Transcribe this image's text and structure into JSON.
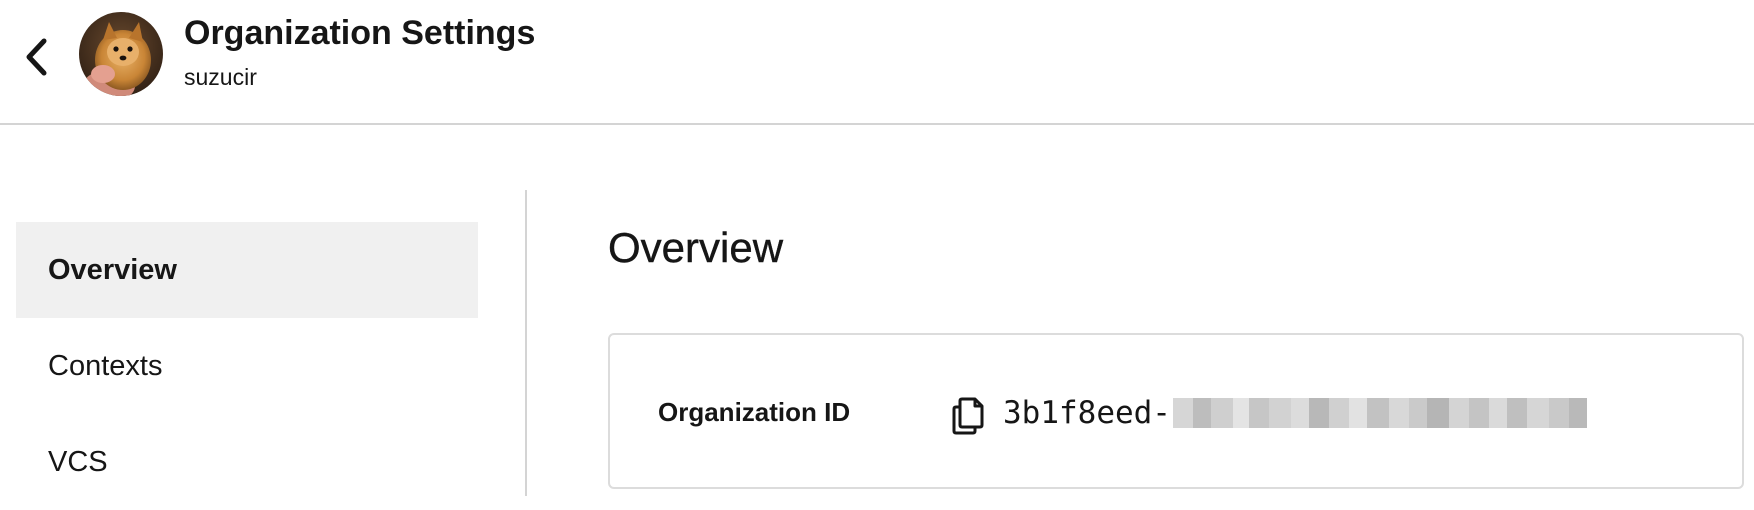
{
  "header": {
    "back_icon": "chevron-left-icon",
    "avatar_alt": "organization-avatar",
    "title": "Organization Settings",
    "subtitle": "suzucir"
  },
  "sidebar": {
    "items": [
      {
        "label": "Overview",
        "active": true
      },
      {
        "label": "Contexts",
        "active": false
      },
      {
        "label": "VCS",
        "active": false
      }
    ]
  },
  "main": {
    "title": "Overview",
    "card": {
      "field_label": "Organization ID",
      "copy_icon": "copy-icon",
      "id_visible_prefix": "3b1f8eed-",
      "id_redacted": true
    }
  },
  "colors": {
    "text": "#161616",
    "active_nav_bg": "#f0f0f0",
    "border": "#d4d4d4"
  }
}
